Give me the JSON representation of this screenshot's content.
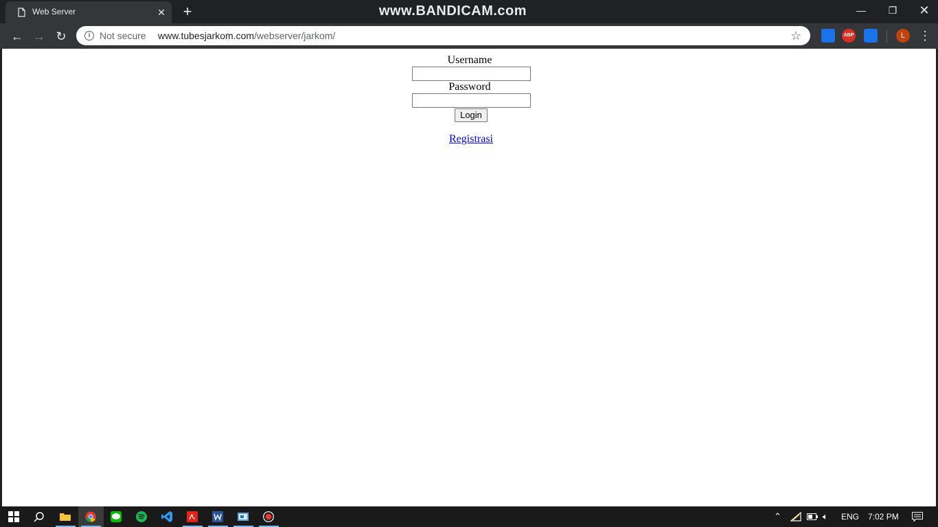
{
  "window": {
    "tab_title": "Web Server",
    "tab_close": "✕",
    "new_tab": "+",
    "watermark": "www.BANDICAM.com",
    "minimize": "—",
    "maximize": "❐",
    "close": "✕"
  },
  "toolbar": {
    "back": "←",
    "forward": "→",
    "reload": "↻",
    "security_label": "Not secure",
    "url_host": "www.tubesjarkom.com",
    "url_path": "/webserver/jarkom/",
    "bookmark": "☆",
    "ext_abp": "ABP",
    "avatar_initial": "L",
    "menu": "⋮"
  },
  "login": {
    "username_label": "Username",
    "username_value": "",
    "password_label": "Password",
    "password_value": "",
    "submit_label": "Login",
    "register_link": "Registrasi"
  },
  "taskbar": {
    "language": "ENG",
    "time": "7:02 PM",
    "apps": [
      "windows-start",
      "search",
      "file-explorer",
      "chrome",
      "line",
      "spotify",
      "vscode",
      "acrobat",
      "word",
      "control-panel",
      "bandicam"
    ],
    "active_app": "chrome"
  },
  "colors": {
    "chrome_dark": "#202124",
    "toolbar": "#35363a",
    "link": "#0000ee",
    "taskbar": "#1a1a1a"
  }
}
